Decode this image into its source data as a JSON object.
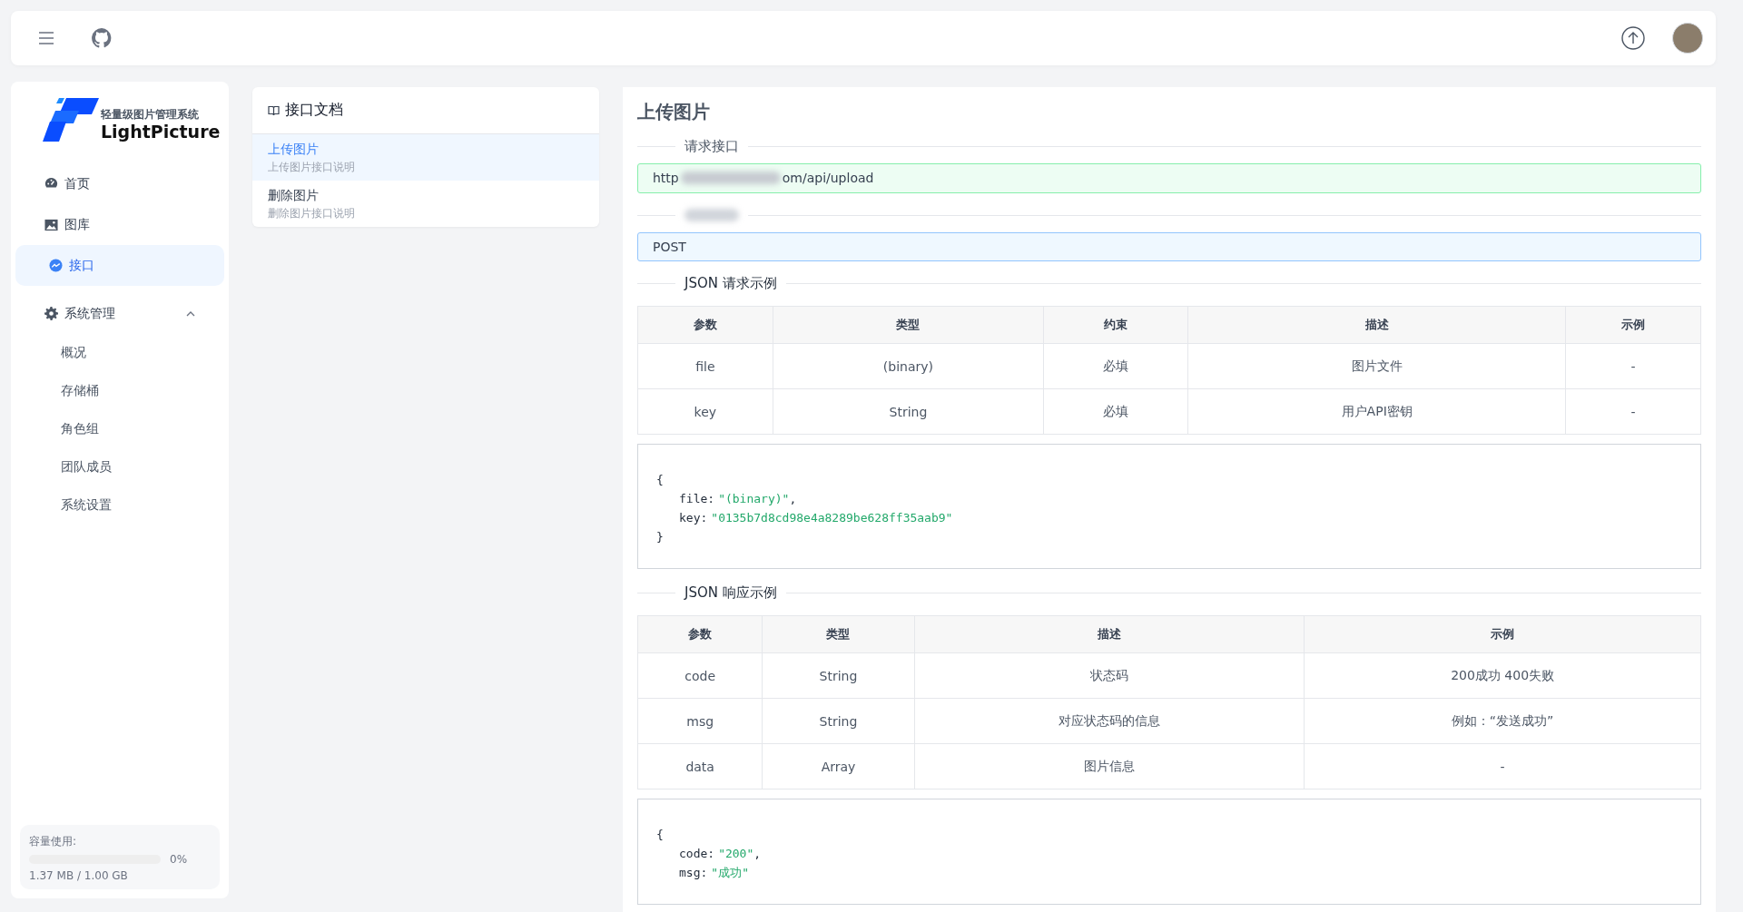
{
  "sidebar": {
    "logo": {
      "subtitle": "轻量级图片管理系统",
      "name": "LightPicture"
    },
    "nav": [
      {
        "label": "首页",
        "kind": "dashboard",
        "selected": false
      },
      {
        "label": "图库",
        "kind": "gallery",
        "selected": false
      },
      {
        "label": "接口",
        "kind": "api",
        "selected": true
      }
    ],
    "group": {
      "label": "系统管理",
      "expanded": true,
      "children": [
        {
          "label": "概况",
          "selected": false
        },
        {
          "label": "存储桶",
          "selected": false
        },
        {
          "label": "角色组",
          "selected": false
        },
        {
          "label": "团队成员",
          "selected": false
        },
        {
          "label": "系统设置",
          "selected": false
        }
      ]
    },
    "storage": {
      "label": "容量使用:",
      "level": 0,
      "percent": "0%",
      "usage": "1.37 MB / 1.00 GB"
    }
  },
  "docs": {
    "title": "接口文档",
    "items": [
      {
        "title": "上传图片",
        "description": "上传图片接口说明",
        "selected": true
      },
      {
        "title": "删除图片",
        "description": "删除图片接口说明",
        "selected": false
      }
    ]
  },
  "main": {
    "title": "上传图片",
    "sections": [
      {
        "kind": "url_field",
        "label": "请求接口",
        "value_start": "http",
        "value_end": "om/api/upload"
      },
      {
        "kind": "method_field",
        "value_start": "POST"
      },
      {
        "kind": "example",
        "label": "JSON 请求示例",
        "columns": [
          "参数",
          "类型",
          "约束",
          "描述",
          "示例"
        ],
        "rows": [
          [
            "file",
            "(binary)",
            "必填",
            "图片文件",
            "-"
          ],
          [
            "key",
            "String",
            "必填",
            "用户API密钥",
            "-"
          ]
        ],
        "code": [
          {
            "kind": "brace",
            "text": "{"
          },
          {
            "kind": "pair",
            "key": "file:",
            "value": "\"(binary)\"",
            "tail": ","
          },
          {
            "kind": "pair",
            "key": "key:",
            "value": "\"0135b7d8cd98e4a8289be628ff35aab9\""
          },
          {
            "kind": "brace",
            "text": "}"
          }
        ]
      },
      {
        "kind": "example",
        "label": "JSON 响应示例",
        "columns": [
          "参数",
          "类型",
          "描述",
          "示例"
        ],
        "rows": [
          [
            "code",
            "String",
            "状态码",
            "200成功 400失败"
          ],
          [
            "msg",
            "String",
            "对应状态码的信息",
            "例如：“发送成功”"
          ],
          [
            "data",
            "Array",
            "图片信息",
            "-"
          ]
        ],
        "code": [
          {
            "kind": "brace",
            "text": "{"
          },
          {
            "kind": "pair",
            "key": "code:",
            "value": "\"200\"",
            "tail": ","
          },
          {
            "kind": "pair",
            "key": "msg:",
            "value": "\"成功\""
          }
        ]
      }
    ]
  }
}
